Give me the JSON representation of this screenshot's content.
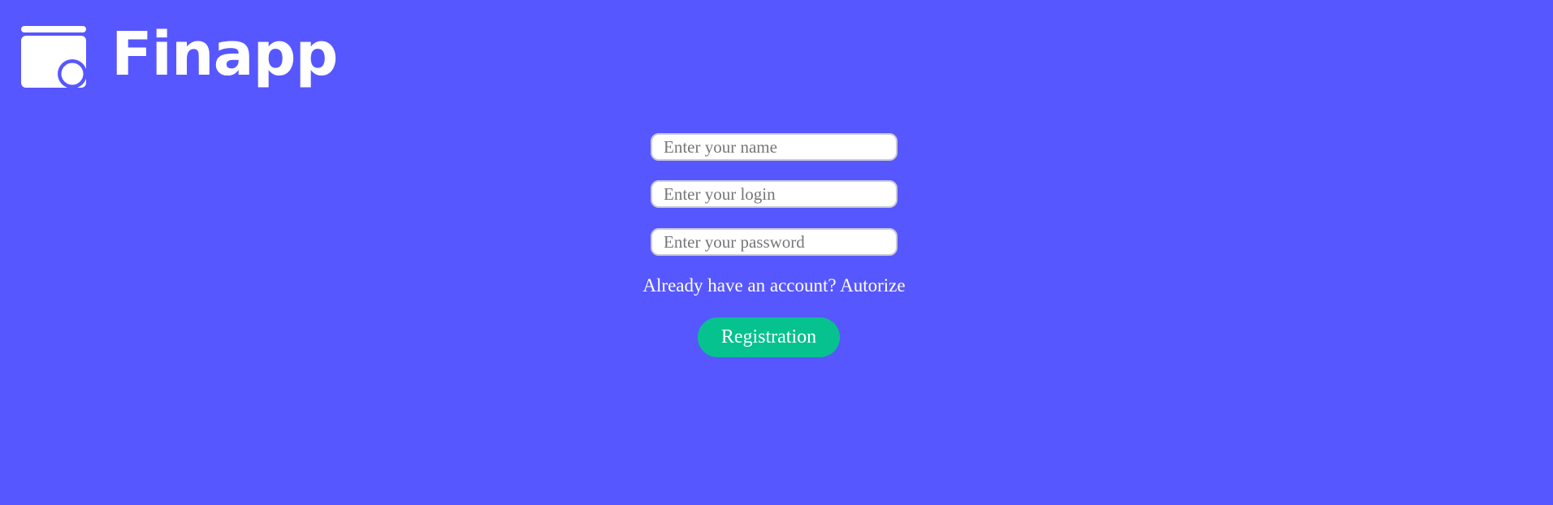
{
  "brand": {
    "name": "Finapp",
    "icon": "wallet-icon"
  },
  "colors": {
    "background": "#5757ff",
    "accent": "#06c28f",
    "text": "#ffffff"
  },
  "form": {
    "name_placeholder": "Enter your name",
    "login_placeholder": "Enter your login",
    "password_placeholder": "Enter your password",
    "name_value": "",
    "login_value": "",
    "password_value": "",
    "account_prompt": "Already have an account?",
    "authorize_link": "Autorize",
    "submit_label": "Registration"
  }
}
